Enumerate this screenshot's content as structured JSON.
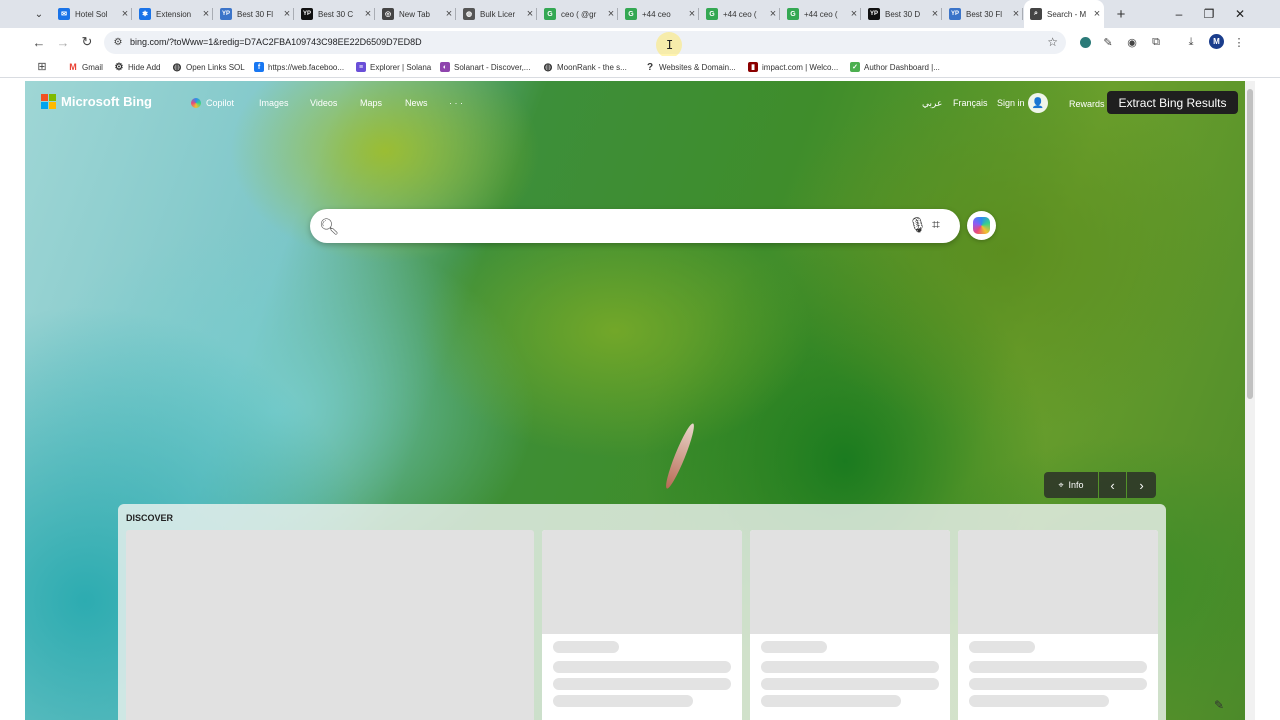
{
  "browser": {
    "tabs": [
      {
        "title": "Hotel Sol",
        "favicon": "mail-icon",
        "color": "#1a73e8",
        "active": false
      },
      {
        "title": "Extension",
        "favicon": "puzzle-icon",
        "color": "#1a73e8",
        "active": false
      },
      {
        "title": "Best 30 Fl",
        "favicon": "yp-icon",
        "color": "#3b74c9",
        "active": false
      },
      {
        "title": "Best 30 C",
        "favicon": "yp-icon",
        "color": "#111111",
        "active": false
      },
      {
        "title": "New Tab",
        "favicon": "chrome-icon",
        "color": "#444444",
        "active": false
      },
      {
        "title": "Bulk Licer",
        "favicon": "globe-icon",
        "color": "#555555",
        "active": false
      },
      {
        "title": "ceo ( @gr",
        "favicon": "google-icon",
        "color": "#34a853",
        "active": false
      },
      {
        "title": "+44 ceo",
        "favicon": "google-icon",
        "color": "#34a853",
        "active": false
      },
      {
        "title": "+44 ceo (",
        "favicon": "google-icon",
        "color": "#34a853",
        "active": false
      },
      {
        "title": "+44 ceo (",
        "favicon": "google-icon",
        "color": "#34a853",
        "active": false
      },
      {
        "title": "Best 30 D",
        "favicon": "yp-icon",
        "color": "#111111",
        "active": false
      },
      {
        "title": "Best 30 Fl",
        "favicon": "yp-icon",
        "color": "#3b74c9",
        "active": false
      },
      {
        "title": "Search - M",
        "favicon": "search-icon",
        "color": "#444444",
        "active": true
      }
    ],
    "new_tab": "+",
    "url": "bing.com/?toWww=1&redig=D7AC2FBA109743C98EE22D6509D7ED8D",
    "profile_initial": "M",
    "bookmarks": [
      {
        "label": "Gmail",
        "icon": "gmail-icon",
        "color": "#ea4335"
      },
      {
        "label": "Hide Add",
        "icon": "settings-icon",
        "color": "#333333"
      },
      {
        "label": "Open Links SOL",
        "icon": "globe-icon",
        "color": "#333333"
      },
      {
        "label": "https://web.faceboo...",
        "icon": "facebook-icon",
        "color": "#1877f2"
      },
      {
        "label": "Explorer | Solana",
        "icon": "list-icon",
        "color": "#6a4fd8"
      },
      {
        "label": "Solanart - Discover,...",
        "icon": "solanart-icon",
        "color": "#8e44ad"
      },
      {
        "label": "MoonRank - the s...",
        "icon": "globe-icon",
        "color": "#333333"
      },
      {
        "label": "Websites & Domain...",
        "icon": "question-icon",
        "color": "#333333"
      },
      {
        "label": "impact.com | Welco...",
        "icon": "impact-icon",
        "color": "#8b0000"
      },
      {
        "label": "Author Dashboard |...",
        "icon": "author-icon",
        "color": "#4caf50"
      }
    ]
  },
  "bing": {
    "brand": "Microsoft Bing",
    "nav": [
      "Copilot",
      "Images",
      "Videos",
      "Maps",
      "News",
      "· · ·"
    ],
    "lang_arabic": "عربي",
    "lang_french": "Français",
    "sign_in": "Sign in",
    "rewards": "Rewards",
    "extension_button": "Extract Bing Results",
    "search_value": "",
    "image_info": "Info",
    "prev": "‹",
    "next": "›",
    "discover_title": "DISCOVER",
    "logo_colors": [
      "#f25022",
      "#7fba00",
      "#00a4ef",
      "#ffb900"
    ]
  }
}
